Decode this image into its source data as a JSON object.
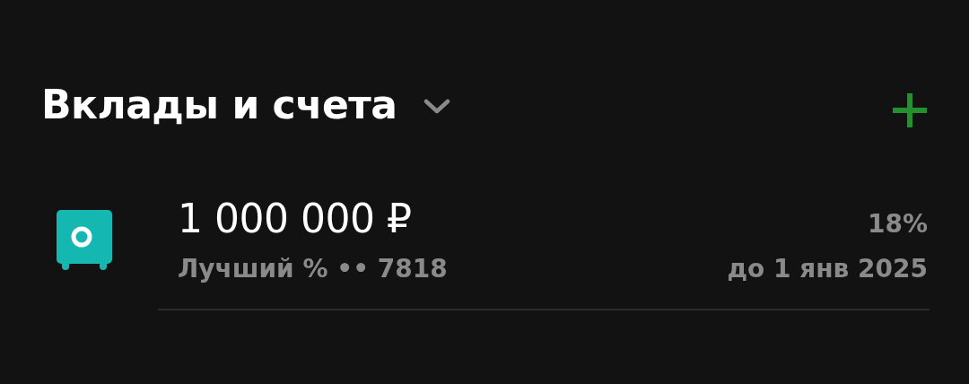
{
  "section": {
    "title": "Вклады и счета"
  },
  "accounts": [
    {
      "amount": "1 000 000 ₽",
      "subtitle": "Лучший % •• 7818",
      "rate": "18%",
      "term": "до 1 янв 2025"
    }
  ]
}
